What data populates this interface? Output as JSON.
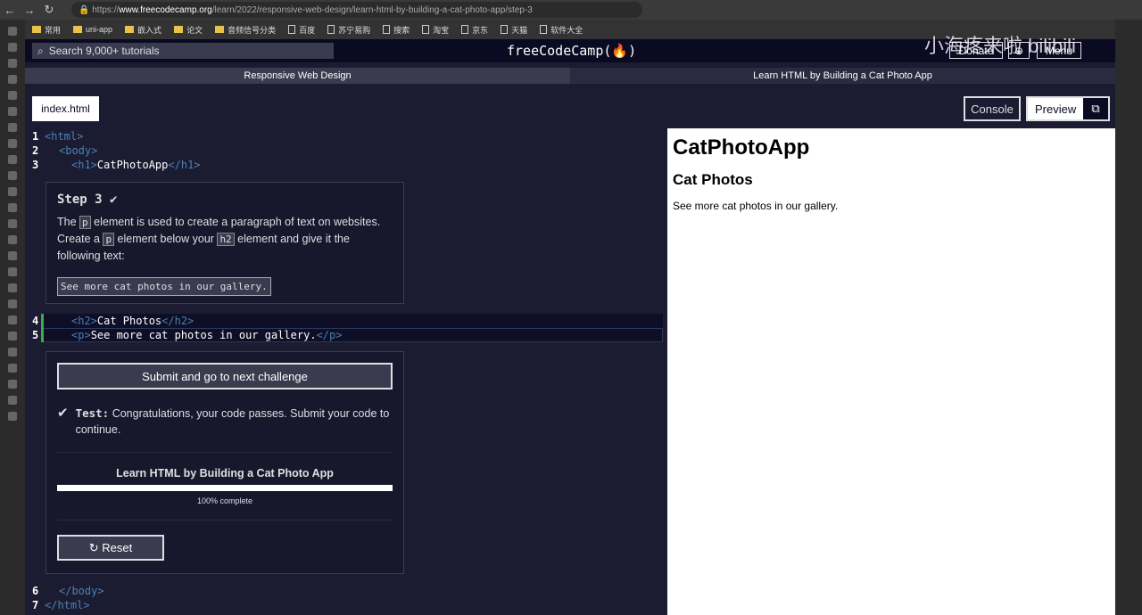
{
  "browser": {
    "url_prefix": "https://",
    "url_domain": "www.freecodecamp.org",
    "url_path": "/learn/2022/responsive-web-design/learn-html-by-building-a-cat-photo-app/step-3",
    "bookmarks": [
      {
        "label": "常用",
        "type": "folder"
      },
      {
        "label": "uni-app",
        "type": "folder"
      },
      {
        "label": "嵌入式",
        "type": "folder"
      },
      {
        "label": "论文",
        "type": "folder"
      },
      {
        "label": "音频信号分类",
        "type": "folder"
      },
      {
        "label": "百度",
        "type": "page"
      },
      {
        "label": "苏宁易购",
        "type": "page"
      },
      {
        "label": "搜索",
        "type": "page"
      },
      {
        "label": "淘宝",
        "type": "page"
      },
      {
        "label": "京东",
        "type": "page"
      },
      {
        "label": "天猫",
        "type": "page"
      },
      {
        "label": "软件大全",
        "type": "page"
      }
    ]
  },
  "watermark": "小海疼来啦 bilibili",
  "nav": {
    "search_placeholder": "Search 9,000+ tutorials",
    "logo": "freeCodeCamp(🔥)",
    "donate": "Donate",
    "menu": "Menu"
  },
  "breadcrumbs": [
    "Responsive Web Design",
    "Learn HTML by Building a Cat Photo App"
  ],
  "tabs": {
    "file": "index.html",
    "console": "Console",
    "preview": "Preview"
  },
  "code": {
    "l1": "<html>",
    "l2": "<body>",
    "l3_open": "<h1>",
    "l3_text": "CatPhotoApp",
    "l3_close": "</h1>",
    "l4_open": "<h2>",
    "l4_text": "Cat Photos",
    "l4_close": "</h2>",
    "l5_open": "<p>",
    "l5_text": "See more cat photos in our gallery.",
    "l5_close": "</p>",
    "l6": "</body>",
    "l7": "</html>"
  },
  "step": {
    "title": "Step 3",
    "t1": "The",
    "c1": "p",
    "t2": "element is used to create a paragraph of text on websites. Create a",
    "c2": "p",
    "t3": "element below your",
    "c3": "h2",
    "t4": "element and give it the following text:",
    "quote": "See more cat photos in our gallery."
  },
  "actions": {
    "submit": "Submit and go to next challenge",
    "test_label": "Test:",
    "test_text": "Congratulations, your code passes. Submit your code to continue.",
    "progress_title": "Learn HTML by Building a Cat Photo App",
    "progress": 100,
    "progress_text": "100% complete",
    "reset": "Reset"
  },
  "preview": {
    "h1": "CatPhotoApp",
    "h2": "Cat Photos",
    "p": "See more cat photos in our gallery."
  }
}
